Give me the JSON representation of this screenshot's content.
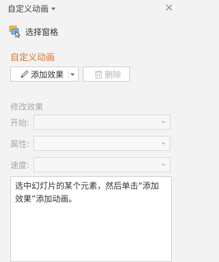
{
  "header": {
    "title": "自定义动画"
  },
  "selection_pane": {
    "label": "选择窗格"
  },
  "section": {
    "title": "自定义动画"
  },
  "buttons": {
    "add_label": "添加效果",
    "delete_label": "删除"
  },
  "modify": {
    "title": "修改效果",
    "start_label": "开始:",
    "property_label": "属性:",
    "speed_label": "速度:"
  },
  "list": {
    "hint": "选中幻灯片的某个元素，然后单击“添加效果”添加动画。"
  },
  "colors": {
    "accent": "#d9722a",
    "disabled_text": "#a8a8a8",
    "background": "#f3f3f3"
  }
}
